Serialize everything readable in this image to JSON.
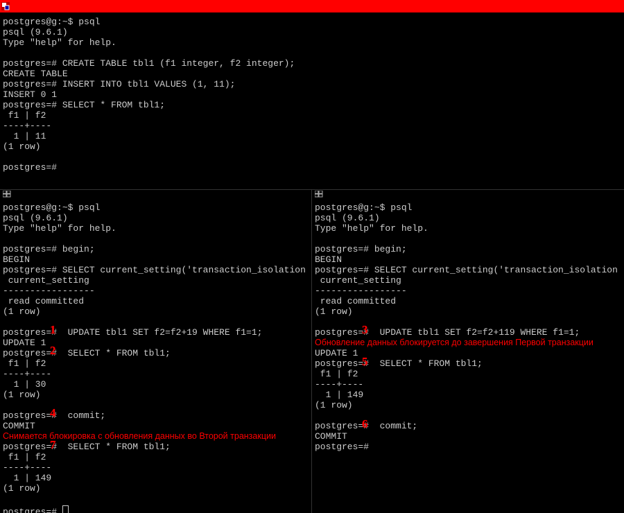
{
  "top": {
    "lines": [
      "postgres@g:~$ psql",
      "psql (9.6.1)",
      "Type \"help\" for help.",
      "",
      "postgres=# CREATE TABLE tbl1 (f1 integer, f2 integer);",
      "CREATE TABLE",
      "postgres=# INSERT INTO tbl1 VALUES (1, 11);",
      "INSERT 0 1",
      "postgres=# SELECT * FROM tbl1;",
      " f1 | f2",
      "----+----",
      "  1 | 11",
      "(1 row)",
      "",
      "postgres=#"
    ]
  },
  "left": {
    "lines": [
      "postgres@g:~$ psql",
      "psql (9.6.1)",
      "Type \"help\" for help.",
      "",
      "postgres=# begin;",
      "BEGIN",
      "postgres=# SELECT current_setting('transaction_isolation",
      " current_setting",
      "-----------------",
      " read committed",
      "(1 row)",
      "",
      "postgres=#  UPDATE tbl1 SET f2=f2+19 WHERE f1=1;",
      "UPDATE 1",
      "postgres=#  SELECT * FROM tbl1;",
      " f1 | f2",
      "----+----",
      "  1 | 30",
      "(1 row)",
      "",
      "postgres=#  commit;",
      "COMMIT"
    ],
    "comment": "Снимается блокировка с обновления данных во Второй транзакции",
    "tail": [
      "postgres=#  SELECT * FROM tbl1;",
      " f1 | f2",
      "----+----",
      "  1 | 149",
      "(1 row)",
      "",
      "postgres=# "
    ]
  },
  "right": {
    "lines": [
      "postgres@g:~$ psql",
      "psql (9.6.1)",
      "Type \"help\" for help.",
      "",
      "postgres=# begin;",
      "BEGIN",
      "postgres=# SELECT current_setting('transaction_isolation",
      " current_setting",
      "-----------------",
      " read committed",
      "(1 row)",
      "",
      "postgres=#  UPDATE tbl1 SET f2=f2+119 WHERE f1=1;"
    ],
    "comment": "Обновление данных блокируется до завершения Первой транзакции",
    "tail": [
      "UPDATE 1",
      "postgres=#  SELECT * FROM tbl1;",
      " f1 | f2",
      "----+----",
      "  1 | 149",
      "(1 row)",
      "",
      "postgres=#  commit;",
      "COMMIT",
      "postgres=#"
    ]
  },
  "annotations": {
    "a1": "1",
    "a2": "2",
    "a3": "3",
    "a4": "4",
    "a5": "5",
    "a6": "6",
    "a7": "7"
  }
}
